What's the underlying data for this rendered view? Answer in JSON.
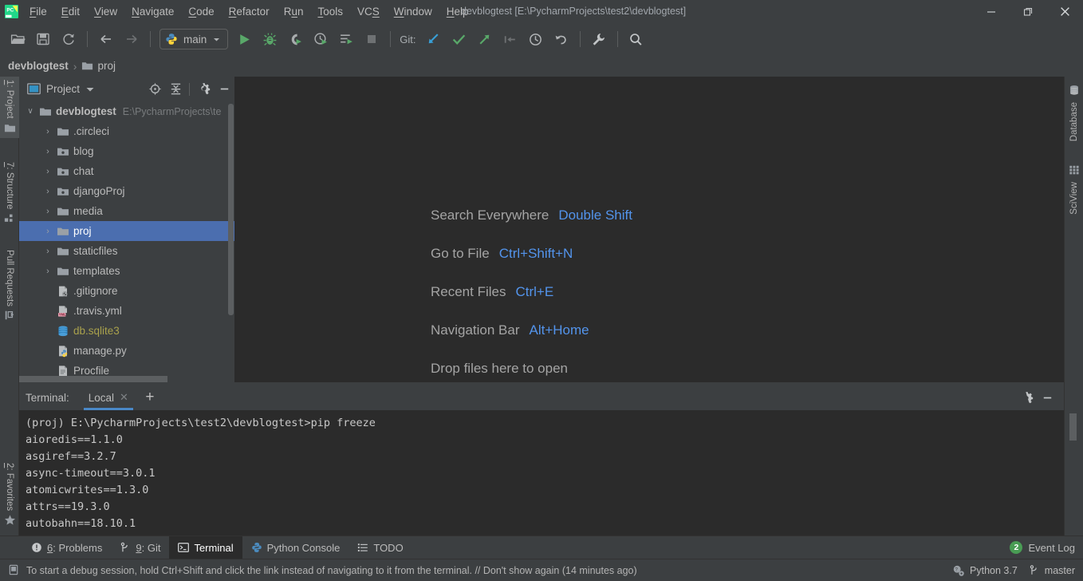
{
  "window": {
    "title": "devblogtest [E:\\PycharmProjects\\test2\\devblogtest]",
    "minimize": "—",
    "maximize": "❐",
    "close": "✕",
    "logo_name": "pycharm-logo"
  },
  "menubar": {
    "items": [
      {
        "label": "File"
      },
      {
        "label": "Edit"
      },
      {
        "label": "View"
      },
      {
        "label": "Navigate"
      },
      {
        "label": "Code"
      },
      {
        "label": "Refactor"
      },
      {
        "label": "Run"
      },
      {
        "label": "Tools"
      },
      {
        "label": "VCS"
      },
      {
        "label": "Window"
      },
      {
        "label": "Help"
      }
    ]
  },
  "toolbar": {
    "open_icon": "open-folder-icon",
    "save_icon": "save-icon",
    "sync_icon": "sync-icon",
    "back_icon": "arrow-left-icon",
    "forward_icon": "arrow-right-icon",
    "run_config": "main",
    "run_config_icon": "python-file-icon",
    "run_icon": "run-icon",
    "debug_icon": "debug-icon",
    "coverage_icon": "run-with-coverage-icon",
    "profile_icon": "profile-icon",
    "run_tests_icon": "run-console-icon",
    "stop_icon": "stop-icon",
    "git_label": "Git:",
    "update_icon": "update-project-icon",
    "commit_icon": "commit-icon",
    "push_icon": "push-icon",
    "rollback_icon": "rollback-changes-icon",
    "history_icon": "history-icon",
    "undo_icon": "undo-icon",
    "settings_icon": "wrench-settings-icon",
    "search_icon": "search-icon"
  },
  "breadcrumb": {
    "root": "devblogtest",
    "separator": "›",
    "folder": "proj",
    "folder_icon": "folder-icon"
  },
  "left_tool_strip": {
    "tabs": [
      {
        "id": "project",
        "label": "1: Project",
        "mnemonic": "1",
        "rest": ": Project",
        "icon": "folder-icon",
        "selected": true
      },
      {
        "id": "structure",
        "label": "7: Structure",
        "mnemonic": "7",
        "rest": ": Structure",
        "icon": "structure-icon",
        "selected": false
      },
      {
        "id": "pull-requests",
        "label": "Pull Requests",
        "mnemonic": "",
        "rest": "Pull Requests",
        "icon": "pull-request-icon",
        "selected": false
      },
      {
        "id": "favorites",
        "label": "2: Favorites",
        "mnemonic": "2",
        "rest": ": Favorites",
        "icon": "star-icon",
        "selected": false
      }
    ]
  },
  "right_tool_strip": {
    "tabs": [
      {
        "id": "database",
        "label": "Database",
        "icon": "database-icon"
      },
      {
        "id": "sciview",
        "label": "SciView",
        "icon": "grid-icon"
      }
    ]
  },
  "project_panel": {
    "title": "Project",
    "dropdown_icon": "chevron-down-icon",
    "view_icon": "project-view-icon",
    "locate_icon": "scroll-from-source-icon",
    "collapse_icon": "collapse-all-icon",
    "settings_icon": "gear-icon",
    "hide_icon": "hide-icon",
    "tree": [
      {
        "indent": 0,
        "arrow": "˅",
        "icon": "folder-icon",
        "name": "devblogtest",
        "bold": true,
        "path": "E:\\PycharmProjects\\te",
        "selected": false,
        "color": "#bbbbbb"
      },
      {
        "indent": 1,
        "arrow": "›",
        "icon": "folder-icon",
        "name": ".circleci",
        "bold": false,
        "path": "",
        "selected": false,
        "color": "#bbbbbb"
      },
      {
        "indent": 1,
        "arrow": "›",
        "icon": "module-folder-icon",
        "name": "blog",
        "bold": false,
        "path": "",
        "selected": false,
        "color": "#bbbbbb"
      },
      {
        "indent": 1,
        "arrow": "›",
        "icon": "module-folder-icon",
        "name": "chat",
        "bold": false,
        "path": "",
        "selected": false,
        "color": "#bbbbbb"
      },
      {
        "indent": 1,
        "arrow": "›",
        "icon": "module-folder-icon",
        "name": "djangoProj",
        "bold": false,
        "path": "",
        "selected": false,
        "color": "#bbbbbb"
      },
      {
        "indent": 1,
        "arrow": "›",
        "icon": "folder-icon",
        "name": "media",
        "bold": false,
        "path": "",
        "selected": false,
        "color": "#bbbbbb"
      },
      {
        "indent": 1,
        "arrow": "›",
        "icon": "folder-icon",
        "name": "proj",
        "bold": false,
        "path": "",
        "selected": true,
        "color": "#ffffff"
      },
      {
        "indent": 1,
        "arrow": "›",
        "icon": "folder-icon",
        "name": "staticfiles",
        "bold": false,
        "path": "",
        "selected": false,
        "color": "#bbbbbb"
      },
      {
        "indent": 1,
        "arrow": "›",
        "icon": "folder-icon",
        "name": "templates",
        "bold": false,
        "path": "",
        "selected": false,
        "color": "#bbbbbb"
      },
      {
        "indent": 1,
        "arrow": "",
        "icon": "gitignore-file-icon",
        "name": ".gitignore",
        "bold": false,
        "path": "",
        "selected": false,
        "color": "#bbbbbb"
      },
      {
        "indent": 1,
        "arrow": "",
        "icon": "yml-file-icon",
        "name": ".travis.yml",
        "bold": false,
        "path": "",
        "selected": false,
        "color": "#bbbbbb"
      },
      {
        "indent": 1,
        "arrow": "",
        "icon": "sqlite-db-icon",
        "name": "db.sqlite3",
        "bold": false,
        "path": "",
        "selected": false,
        "color": "#a9a14c"
      },
      {
        "indent": 1,
        "arrow": "",
        "icon": "python-file-icon",
        "name": "manage.py",
        "bold": false,
        "path": "",
        "selected": false,
        "color": "#bbbbbb"
      },
      {
        "indent": 1,
        "arrow": "",
        "icon": "text-file-icon",
        "name": "Procfile",
        "bold": false,
        "path": "",
        "selected": false,
        "color": "#bbbbbb"
      }
    ]
  },
  "editor": {
    "hints": [
      {
        "label": "Search Everywhere",
        "key": "Double Shift"
      },
      {
        "label": "Go to File",
        "key": "Ctrl+Shift+N"
      },
      {
        "label": "Recent Files",
        "key": "Ctrl+E"
      },
      {
        "label": "Navigation Bar",
        "key": "Alt+Home"
      },
      {
        "label": "Drop files here to open",
        "key": ""
      }
    ]
  },
  "terminal": {
    "label": "Terminal:",
    "tab_name": "Local",
    "close_icon": "close-icon",
    "add_icon": "add-tab-icon",
    "settings_icon": "gear-icon",
    "hide_icon": "hide-icon",
    "lines": [
      "(proj) E:\\PycharmProjects\\test2\\devblogtest>pip freeze",
      "aioredis==1.1.0",
      "asgiref==3.2.7",
      "async-timeout==3.0.1",
      "atomicwrites==1.3.0",
      "attrs==19.3.0",
      "autobahn==18.10.1"
    ]
  },
  "bottom_bar": {
    "tabs": [
      {
        "id": "problems",
        "mnemonic": "6",
        "rest": ": Problems",
        "icon": "warning-icon",
        "active": false
      },
      {
        "id": "git",
        "mnemonic": "9",
        "rest": ": Git",
        "icon": "branch-icon",
        "active": false
      },
      {
        "id": "terminal",
        "mnemonic": "",
        "rest": "Terminal",
        "icon": "terminal-icon",
        "active": true
      },
      {
        "id": "python-console",
        "mnemonic": "",
        "rest": "Python Console",
        "icon": "python-icon",
        "active": false
      },
      {
        "id": "todo",
        "mnemonic": "",
        "rest": "TODO",
        "icon": "list-icon",
        "active": false
      }
    ],
    "event_log_label": "Event Log",
    "event_log_count": "2"
  },
  "status_bar": {
    "message_icon": "tip-icon",
    "message": "To start a debug session, hold Ctrl+Shift and click the link instead of navigating to it from the terminal. // Don't show again (14 minutes ago)",
    "interpreter": "Python 3.7",
    "interpreter_icon": "python-settings-icon",
    "branch": "master",
    "branch_icon": "branch-icon"
  },
  "colors": {
    "chrome": "#3c3f41",
    "editor_bg": "#2b2b2b",
    "selection": "#4b6eaf",
    "accent_blue": "#5394ec",
    "green": "#499c54",
    "text": "#bbbbbb",
    "muted": "#787b7d"
  }
}
